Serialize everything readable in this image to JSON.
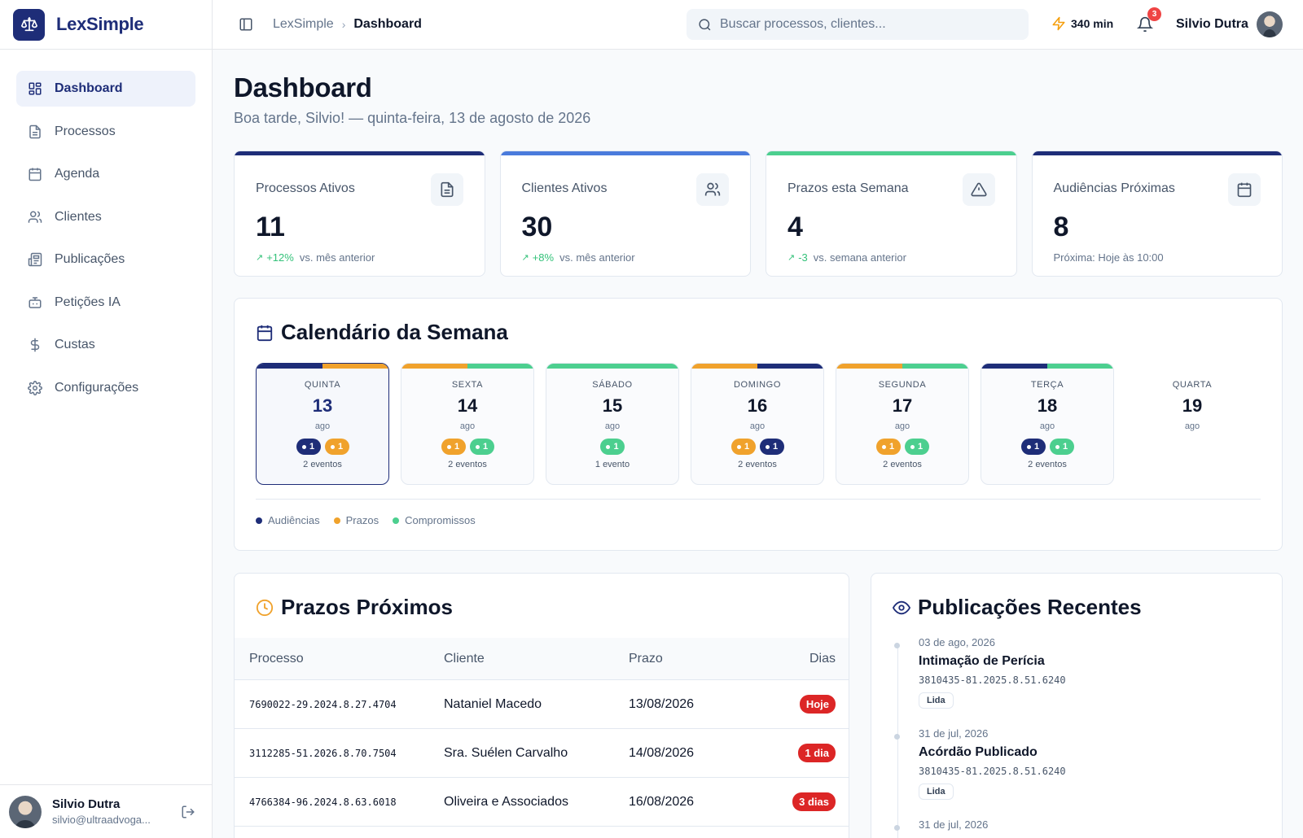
{
  "app": {
    "name": "LexSimple"
  },
  "sidebar": {
    "items": [
      {
        "label": "Dashboard",
        "icon": "dashboard-icon",
        "active": true
      },
      {
        "label": "Processos",
        "icon": "file-icon"
      },
      {
        "label": "Agenda",
        "icon": "calendar-icon"
      },
      {
        "label": "Clientes",
        "icon": "users-icon"
      },
      {
        "label": "Publicações",
        "icon": "newspaper-icon"
      },
      {
        "label": "Petições IA",
        "icon": "bot-icon"
      },
      {
        "label": "Custas",
        "icon": "dollar-icon"
      },
      {
        "label": "Configurações",
        "icon": "gear-icon"
      }
    ],
    "user": {
      "name": "Silvio Dutra",
      "email": "silvio@ultraadvoga..."
    }
  },
  "header": {
    "breadcrumb": [
      "LexSimple",
      "Dashboard"
    ],
    "search_placeholder": "Buscar processos, clientes...",
    "credits": "340 min",
    "notifications": "3",
    "user_name": "Silvio Dutra"
  },
  "page": {
    "title": "Dashboard",
    "subtitle": "Boa tarde, Silvio! — quinta-feira, 13 de agosto de 2026"
  },
  "stats": [
    {
      "label": "Processos Ativos",
      "value": "11",
      "delta": "+12%",
      "foot": "vs. mês anterior",
      "color": "#1e2d78",
      "icon": "document-icon"
    },
    {
      "label": "Clientes Ativos",
      "value": "30",
      "delta": "+8%",
      "foot": "vs. mês anterior",
      "color": "#4a7bdc",
      "icon": "users-icon"
    },
    {
      "label": "Prazos esta Semana",
      "value": "4",
      "delta": "-3",
      "foot": "vs. semana anterior",
      "color": "#4ccf8f",
      "icon": "alert-triangle-icon"
    },
    {
      "label": "Audiências Próximas",
      "value": "8",
      "delta": "",
      "foot": "Próxima: Hoje às 10:00",
      "color": "#1e2d78",
      "icon": "calendar-icon"
    }
  ],
  "calendar": {
    "title": "Calendário da Semana",
    "days": [
      {
        "name": "QUINTA",
        "date": "13",
        "month": "ago",
        "events": [
          {
            "type": "aud",
            "n": "1"
          },
          {
            "type": "prazo",
            "n": "1"
          }
        ],
        "count": "2 eventos",
        "today": true
      },
      {
        "name": "SEXTA",
        "date": "14",
        "month": "ago",
        "events": [
          {
            "type": "prazo",
            "n": "1"
          },
          {
            "type": "comp",
            "n": "1"
          }
        ],
        "count": "2 eventos"
      },
      {
        "name": "SÁBADO",
        "date": "15",
        "month": "ago",
        "events": [
          {
            "type": "comp",
            "n": "1"
          }
        ],
        "count": "1 evento"
      },
      {
        "name": "DOMINGO",
        "date": "16",
        "month": "ago",
        "events": [
          {
            "type": "prazo",
            "n": "1"
          },
          {
            "type": "aud",
            "n": "1"
          }
        ],
        "count": "2 eventos"
      },
      {
        "name": "SEGUNDA",
        "date": "17",
        "month": "ago",
        "events": [
          {
            "type": "prazo",
            "n": "1"
          },
          {
            "type": "comp",
            "n": "1"
          }
        ],
        "count": "2 eventos"
      },
      {
        "name": "TERÇA",
        "date": "18",
        "month": "ago",
        "events": [
          {
            "type": "aud",
            "n": "1"
          },
          {
            "type": "comp",
            "n": "1"
          }
        ],
        "count": "2 eventos"
      },
      {
        "name": "QUARTA",
        "date": "19",
        "month": "ago",
        "events": [],
        "count": ""
      }
    ],
    "legend": [
      {
        "label": "Audiências",
        "type": "aud"
      },
      {
        "label": "Prazos",
        "type": "prazo"
      },
      {
        "label": "Compromissos",
        "type": "comp"
      }
    ],
    "colors": {
      "aud": "#1e2d78",
      "prazo": "#f0a22c",
      "comp": "#4ccf8f"
    }
  },
  "deadlines": {
    "title": "Prazos Próximos",
    "columns": [
      "Processo",
      "Cliente",
      "Prazo",
      "Dias"
    ],
    "rows": [
      {
        "process": "7690022-29.2024.8.27.4704",
        "client": "Nataniel Macedo",
        "date": "13/08/2026",
        "days": "Hoje"
      },
      {
        "process": "3112285-51.2026.8.70.7504",
        "client": "Sra. Suélen Carvalho",
        "date": "14/08/2026",
        "days": "1 dia"
      },
      {
        "process": "4766384-96.2024.8.63.6018",
        "client": "Oliveira e Associados",
        "date": "16/08/2026",
        "days": "3 dias"
      }
    ]
  },
  "publications": {
    "title": "Publicações Recentes",
    "items": [
      {
        "date": "03 de ago, 2026",
        "title": "Intimação de Perícia",
        "number": "3810435-81.2025.8.51.6240",
        "status": "Lida"
      },
      {
        "date": "31 de jul, 2026",
        "title": "Acórdão Publicado",
        "number": "3810435-81.2025.8.51.6240",
        "status": "Lida"
      },
      {
        "date": "31 de jul, 2026",
        "title": "",
        "number": "",
        "status": ""
      }
    ]
  }
}
